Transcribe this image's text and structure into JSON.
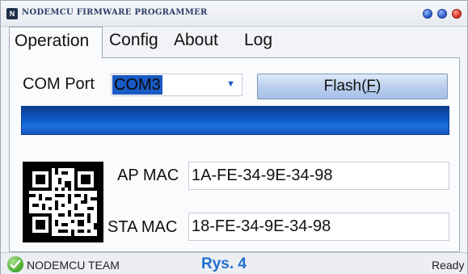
{
  "window": {
    "title": "NODEMCU FIRMWARE PROGRAMMER",
    "icon_letter": "N",
    "accent_color": "#1b5ac4",
    "close_color": "#d22d1c"
  },
  "tabs": [
    {
      "label": "Operation",
      "active": true
    },
    {
      "label": "Config",
      "active": false
    },
    {
      "label": "About",
      "active": false
    },
    {
      "label": "Log",
      "active": false
    }
  ],
  "operation": {
    "com_port_label": "COM Port",
    "com_port_value": "COM3",
    "flash_label_prefix": "Flash(",
    "flash_label_mnemonic": "F",
    "flash_label_suffix": ")",
    "progress_fraction": 1.0,
    "ap_mac_label": "AP MAC",
    "ap_mac_value": "1A-FE-34-9E-34-98",
    "sta_mac_label": "STA MAC",
    "sta_mac_value": "18-FE-34-9E-34-98"
  },
  "status": {
    "team_label": "NODEMCU TEAM",
    "figure_label": "Rys. 4",
    "state": "Ready",
    "icon": "check-icon"
  }
}
